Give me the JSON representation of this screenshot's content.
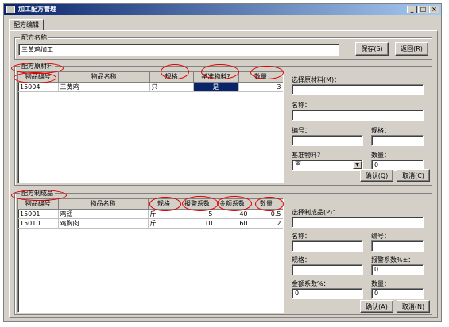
{
  "window": {
    "title": "加工配方管理",
    "buttons": [
      "_",
      "□",
      "×"
    ]
  },
  "tab": {
    "label": "配方编辑"
  },
  "recipe_name": {
    "group_label": "配方名称",
    "value": "三黄鸡加工",
    "save_label": "保存(S)",
    "back_label": "返回(R)"
  },
  "materials": {
    "group_label": "配方原材料",
    "columns": [
      "物品编号",
      "物品名称",
      "规格",
      "基准物料?",
      "数量"
    ],
    "rows": [
      [
        "15004",
        "三黄鸡",
        "只",
        "是",
        "3"
      ]
    ],
    "form": {
      "select_label": "选择原材料(M)：",
      "name_label": "名称：",
      "code_label": "编号：",
      "spec_label": "规格：",
      "base_label": "基准物料?",
      "base_value": "否",
      "qty_label": "数量：",
      "qty_value": "0",
      "ok_label": "确认(Q)",
      "cancel_label": "取消(C)"
    }
  },
  "products": {
    "group_label": "配方制成品",
    "columns": [
      "物品编号",
      "物品名称",
      "规格",
      "报警系数",
      "金额系数",
      "数量"
    ],
    "rows": [
      [
        "15001",
        "鸡翅",
        "斤",
        "5",
        "40",
        "0.5"
      ],
      [
        "15010",
        "鸡胸肉",
        "斤",
        "10",
        "60",
        "2"
      ]
    ],
    "form": {
      "select_label": "选择制成品(P)：",
      "name_label": "名称：",
      "code_label": "编号：",
      "spec_label": "规格：",
      "alarm_label": "报警系数%±：",
      "alarm_value": "0",
      "amount_label": "金额系数%：",
      "amount_value": "0",
      "qty_label": "数量：",
      "qty_value": "0",
      "ok_label": "确认(A)",
      "cancel_label": "取消(N)"
    }
  }
}
